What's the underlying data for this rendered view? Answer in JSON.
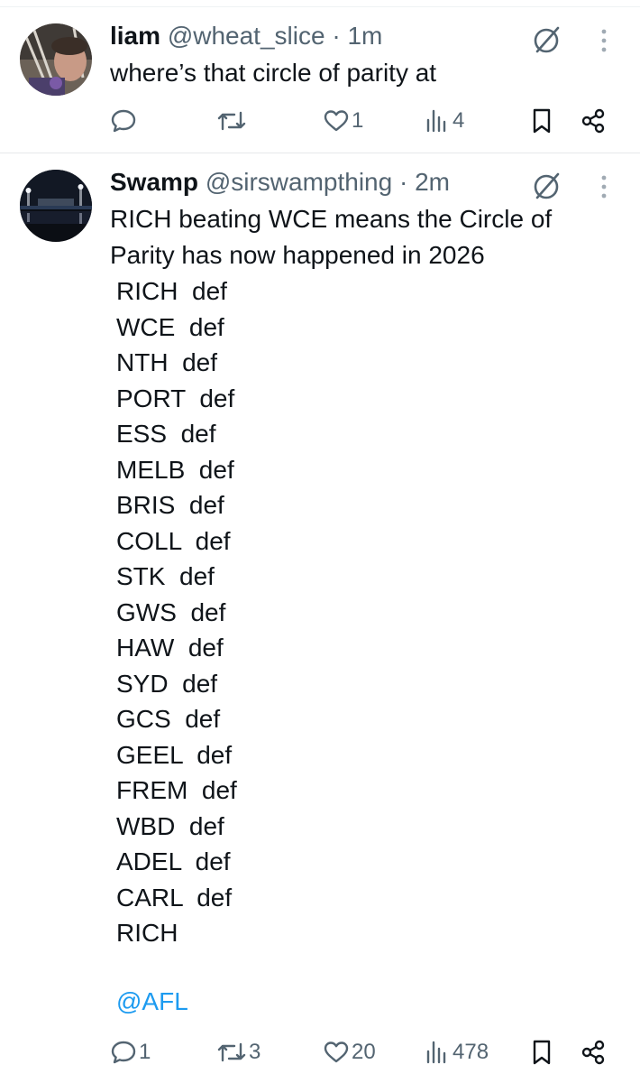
{
  "tweets": [
    {
      "name": "liam",
      "handle": "@wheat_slice",
      "dot": "·",
      "time": "1m",
      "text": "where’s that circle of parity at",
      "actions": {
        "replies": "",
        "reposts": "",
        "likes": "1",
        "views": "4"
      }
    },
    {
      "name": "Swamp",
      "handle": "@sirswampthing",
      "dot": "·",
      "time": "2m",
      "text_line1": "RICH beating WCE means the Circle of",
      "text_line2": "Parity has now happened in 2026",
      "list": [
        "RICH  def",
        "WCE  def",
        "NTH  def",
        "PORT  def",
        "ESS  def",
        "MELB  def",
        "BRIS  def",
        "COLL  def",
        "STK  def",
        "GWS  def",
        "HAW  def",
        "SYD  def",
        "GCS  def",
        "GEEL  def",
        "FREM  def",
        "WBD  def",
        "ADEL  def",
        "CARL  def",
        "RICH"
      ],
      "mention": "@AFL",
      "actions": {
        "replies": "1",
        "reposts": "3",
        "likes": "20",
        "views": "478"
      }
    }
  ],
  "icons": [
    "reply-icon",
    "repost-icon",
    "like-icon",
    "views-icon",
    "bookmark-icon",
    "share-icon",
    "grok-icon",
    "more-icon"
  ],
  "colors": {
    "text": "#0f1419",
    "muted": "#536471",
    "link": "#1d9bf0",
    "divider": "#eff3f4"
  }
}
